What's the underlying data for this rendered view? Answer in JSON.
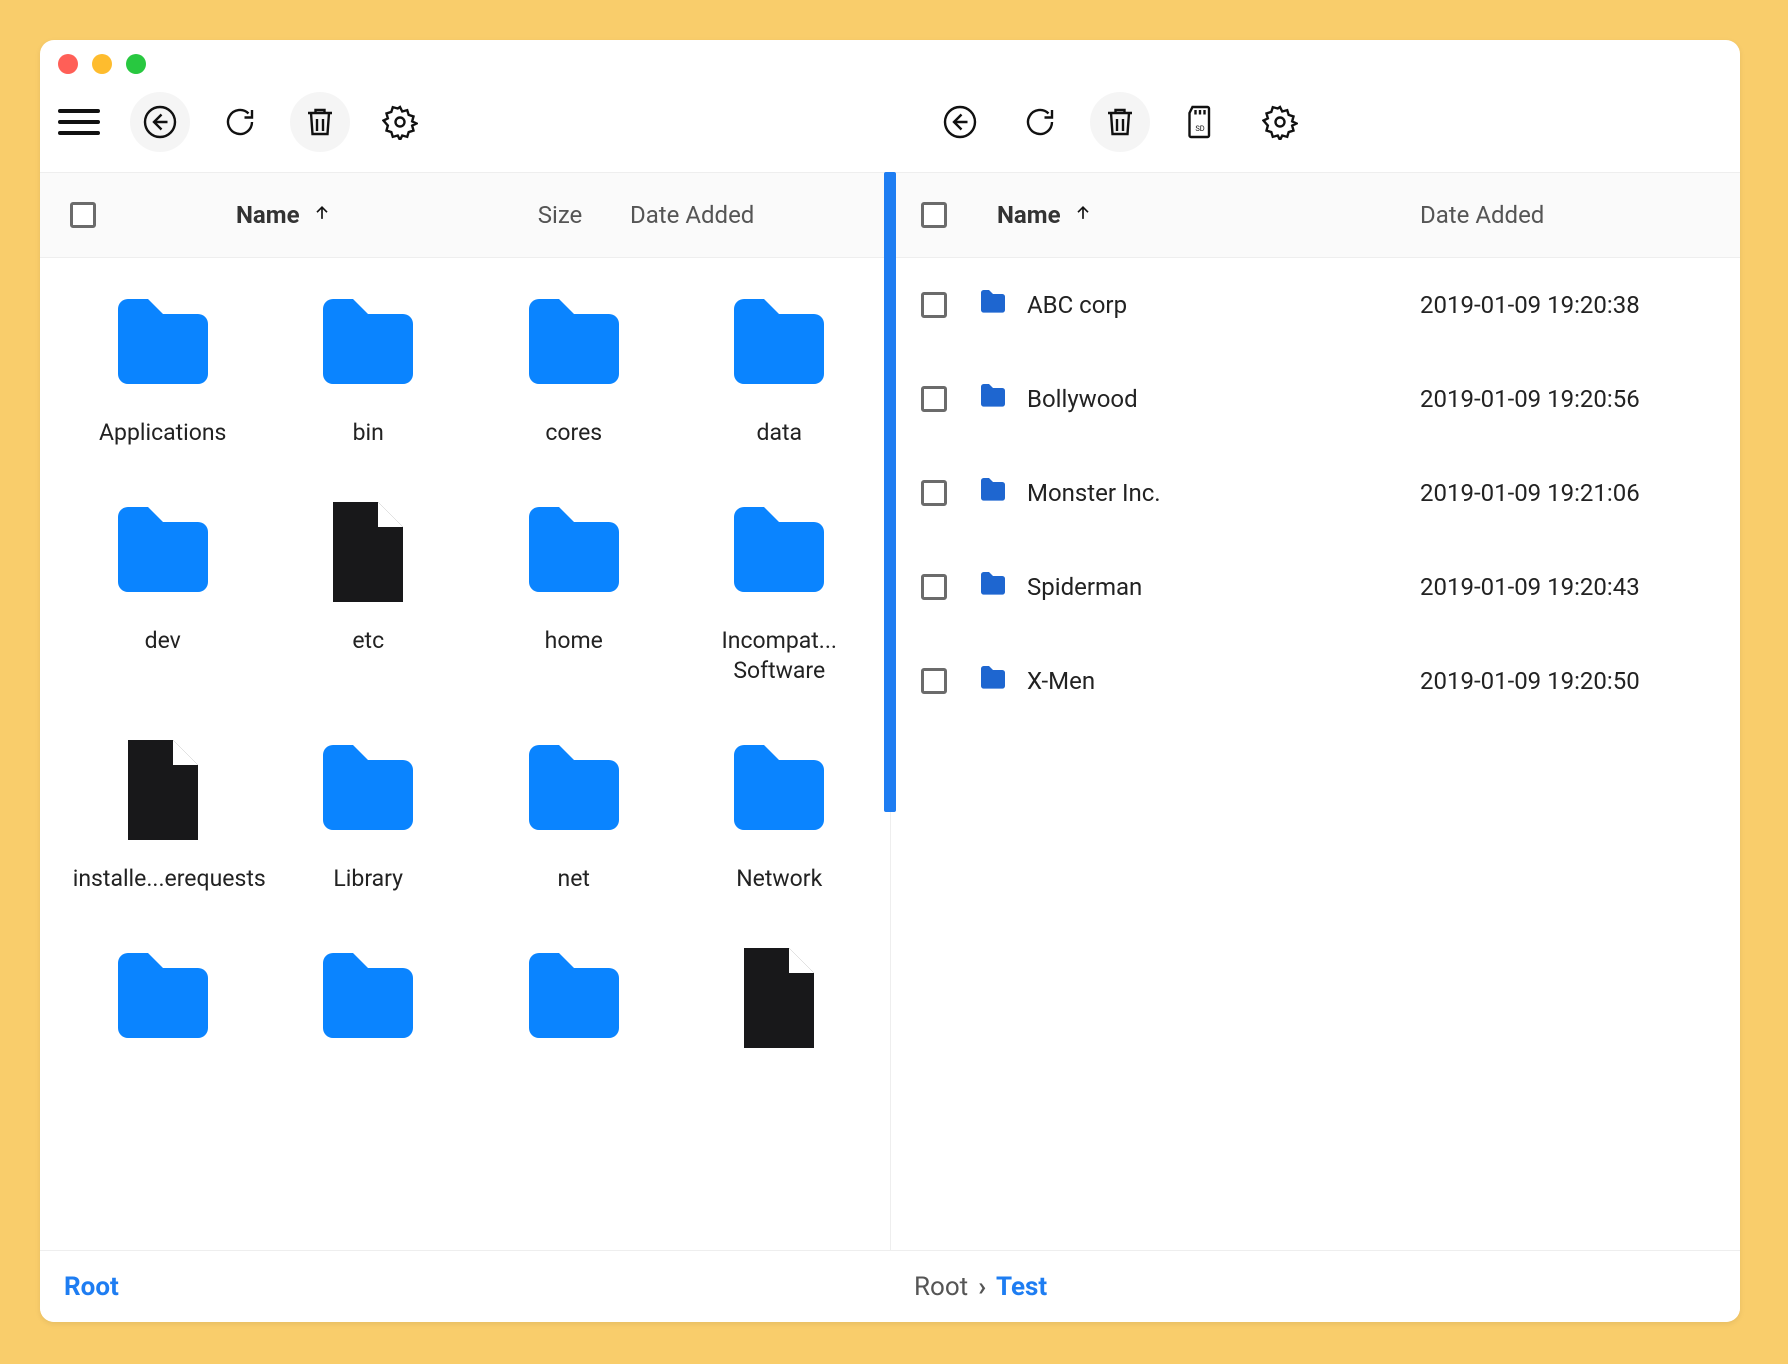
{
  "left": {
    "columns": {
      "name": "Name",
      "size": "Size",
      "date": "Date Added"
    },
    "sort": {
      "column": "name",
      "dir": "asc"
    },
    "breadcrumbs": [
      "Root"
    ],
    "items": [
      {
        "label": "Applications",
        "kind": "folder"
      },
      {
        "label": "bin",
        "kind": "folder"
      },
      {
        "label": "cores",
        "kind": "folder"
      },
      {
        "label": "data",
        "kind": "folder"
      },
      {
        "label": "dev",
        "kind": "folder"
      },
      {
        "label": "etc",
        "kind": "file"
      },
      {
        "label": "home",
        "kind": "folder"
      },
      {
        "label": "Incompat... Software",
        "kind": "folder"
      },
      {
        "label": "installe...erequests",
        "kind": "file"
      },
      {
        "label": "Library",
        "kind": "folder"
      },
      {
        "label": "net",
        "kind": "folder"
      },
      {
        "label": "Network",
        "kind": "folder"
      },
      {
        "label": "",
        "kind": "folder"
      },
      {
        "label": "",
        "kind": "folder"
      },
      {
        "label": "",
        "kind": "folder"
      },
      {
        "label": "",
        "kind": "file"
      }
    ]
  },
  "right": {
    "columns": {
      "name": "Name",
      "date": "Date Added"
    },
    "sort": {
      "column": "name",
      "dir": "asc"
    },
    "breadcrumbs": [
      "Root",
      "Test"
    ],
    "items": [
      {
        "label": "ABC corp",
        "date": "2019-01-09 19:20:38",
        "kind": "folder"
      },
      {
        "label": "Bollywood",
        "date": "2019-01-09 19:20:56",
        "kind": "folder"
      },
      {
        "label": "Monster Inc.",
        "date": "2019-01-09 19:21:06",
        "kind": "folder"
      },
      {
        "label": "Spiderman",
        "date": "2019-01-09 19:20:43",
        "kind": "folder"
      },
      {
        "label": "X-Men",
        "date": "2019-01-09 19:20:50",
        "kind": "folder"
      }
    ]
  },
  "colors": {
    "accent": "#1e7df2",
    "folder": "#0a84ff",
    "file": "#18181a"
  }
}
